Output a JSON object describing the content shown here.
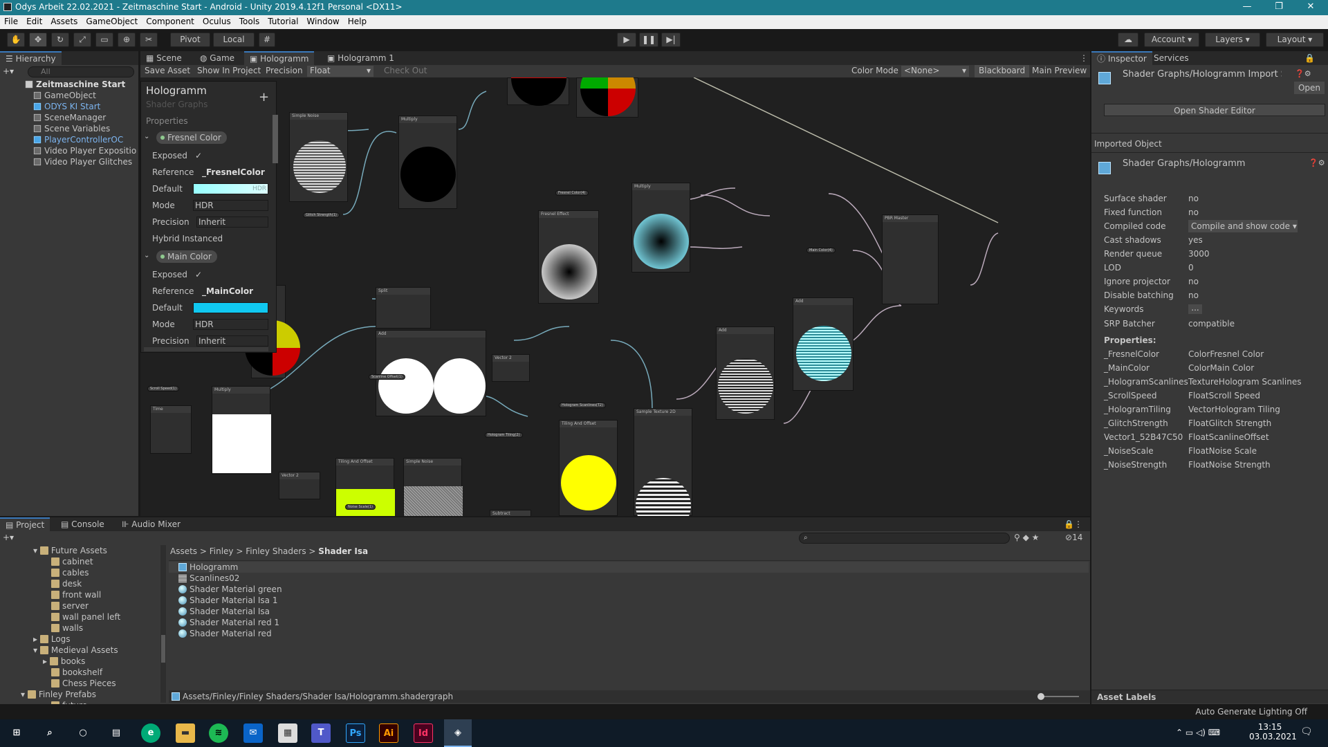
{
  "window": {
    "title": "Odys Arbeit 22.02.2021 - Zeitmaschine Start - Android - Unity 2019.4.12f1 Personal <DX11>",
    "min": "—",
    "max": "❐",
    "close": "✕"
  },
  "menu": [
    "File",
    "Edit",
    "Assets",
    "GameObject",
    "Component",
    "Oculus",
    "Tools",
    "Tutorial",
    "Window",
    "Help"
  ],
  "toolbar": {
    "pivot": "Pivot",
    "local": "Local",
    "account": "Account",
    "layers": "Layers",
    "layout": "Layout"
  },
  "hierarchy": {
    "tab": "Hierarchy",
    "search_placeholder": "All",
    "scene": "Zeitmaschine Start",
    "items": [
      "GameObject",
      "ODYS KI Start",
      "SceneManager",
      "Scene Variables",
      "PlayerControllerOC",
      "Video Player Expositio",
      "Video Player Glitches"
    ]
  },
  "center_tabs": [
    "Scene",
    "Game",
    "Hologramm",
    "Hologramm 1"
  ],
  "graph_toolbar": {
    "save": "Save Asset",
    "show": "Show In Project",
    "precision_label": "Precision",
    "precision_value": "Float",
    "checkout": "Check Out",
    "color_mode_label": "Color Mode",
    "color_mode_value": "<None>",
    "blackboard": "Blackboard",
    "main_preview": "Main Preview"
  },
  "blackboard": {
    "title": "Hologramm",
    "subtitle": "Shader Graphs",
    "properties": "Properties",
    "fresnel": {
      "name": "Fresnel Color",
      "exposed": "Exposed",
      "reference_label": "Reference",
      "reference": "_FresnelColor",
      "default_label": "Default",
      "hdr": "HDR",
      "mode_label": "Mode",
      "mode": "HDR",
      "precision_label": "Precision",
      "precision": "Inherit",
      "hybrid": "Hybrid Instanced (experimen"
    },
    "main": {
      "name": "Main Color",
      "exposed": "Exposed",
      "reference_label": "Reference",
      "reference": "_MainColor",
      "default_label": "Default",
      "mode_label": "Mode",
      "mode": "HDR",
      "precision_label": "Precision",
      "precision": "Inherit"
    },
    "add": "+"
  },
  "graph_nodes": {
    "simple_noise": "Simple Noise",
    "multiply": "Multiply",
    "fresnel": "Fresnel Effect",
    "pbr": "PBR Master",
    "add": "Add",
    "split": "Split",
    "time": "Time",
    "vector2": "Vector 2",
    "tiling": "Tiling And Offset",
    "sample": "Sample Texture 2D",
    "subtract": "Subtract",
    "props": [
      "Fresnel Color(4)",
      "Main Color(4)",
      "Scroll Speed(1)",
      "Hologram Scanlines(T2)",
      "Hologram Tiling(2)",
      "Glitch Strength(1)",
      "Scanline Offset(1)",
      "Noise Scale(1)"
    ]
  },
  "inspector": {
    "tabs": [
      "Inspector",
      "Services"
    ],
    "asset": "Shader Graphs/Hologramm Import Sett",
    "open": "Open",
    "open_editor": "Open Shader Editor",
    "imported": "Imported Object",
    "shader_name": "Shader Graphs/Hologramm",
    "rows": [
      {
        "k": "Surface shader",
        "v": "no"
      },
      {
        "k": "Fixed function",
        "v": "no"
      },
      {
        "k": "Compiled code",
        "v": "Compile and show code"
      },
      {
        "k": "Cast shadows",
        "v": "yes"
      },
      {
        "k": "Render queue",
        "v": "3000"
      },
      {
        "k": "LOD",
        "v": "0"
      },
      {
        "k": "Ignore projector",
        "v": "no"
      },
      {
        "k": "Disable batching",
        "v": "no"
      },
      {
        "k": "Keywords",
        "v": "..."
      },
      {
        "k": "SRP Batcher",
        "v": "compatible"
      }
    ],
    "props_title": "Properties:",
    "props": [
      {
        "k": "_FresnelColor",
        "v": "ColorFresnel Color"
      },
      {
        "k": "_MainColor",
        "v": "ColorMain Color"
      },
      {
        "k": "_HologramScanlines",
        "v": "TextureHologram Scanlines"
      },
      {
        "k": "_ScrollSpeed",
        "v": "FloatScroll Speed"
      },
      {
        "k": "_HologramTiling",
        "v": "VectorHologram Tiling"
      },
      {
        "k": "_GlitchStrength",
        "v": "FloatGlitch Strength"
      },
      {
        "k": "Vector1_52B47C50",
        "v": "FloatScanlineOffset"
      },
      {
        "k": "_NoiseScale",
        "v": "FloatNoise Scale"
      },
      {
        "k": "_NoiseStrength",
        "v": "FloatNoise Strength"
      }
    ],
    "asset_labels": "Asset Labels"
  },
  "project": {
    "tabs": [
      "Project",
      "Console",
      "Audio Mixer"
    ],
    "count": "14",
    "tree": [
      {
        "name": "Future Assets",
        "indent": 1,
        "open": true
      },
      {
        "name": "cabinet",
        "indent": 2
      },
      {
        "name": "cables",
        "indent": 2
      },
      {
        "name": "desk",
        "indent": 2
      },
      {
        "name": "front wall",
        "indent": 2
      },
      {
        "name": "server",
        "indent": 2
      },
      {
        "name": "wall panel left",
        "indent": 2
      },
      {
        "name": "walls",
        "indent": 2
      },
      {
        "name": "Logs",
        "indent": 1
      },
      {
        "name": "Medieval Assets",
        "indent": 1,
        "open": true
      },
      {
        "name": "books",
        "indent": 2
      },
      {
        "name": "bookshelf",
        "indent": 2
      },
      {
        "name": "Chess Pieces",
        "indent": 2
      },
      {
        "name": "Finley Prefabs",
        "indent": 0,
        "open": true
      },
      {
        "name": "future",
        "indent": 2
      }
    ],
    "breadcrumb": [
      "Assets",
      "Finley",
      "Finley Shaders",
      "Shader Isa"
    ],
    "files": [
      "Hologramm",
      "Scanlines02",
      "Shader Material green",
      "Shader Material Isa 1",
      "Shader Material Isa",
      "Shader Material red 1",
      "Shader Material red"
    ],
    "path": "Assets/Finley/Finley Shaders/Shader Isa/Hologramm.shadergraph"
  },
  "status": "Auto Generate Lighting Off",
  "taskbar": {
    "time": "13:15",
    "date": "03.03.2021"
  }
}
